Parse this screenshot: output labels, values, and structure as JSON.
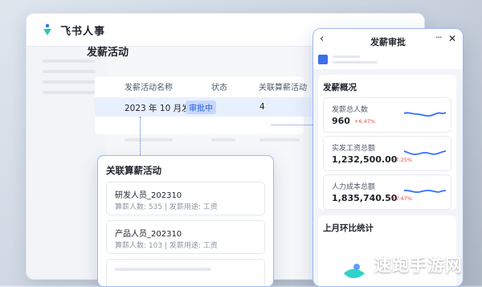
{
  "app": {
    "title": "飞书人事"
  },
  "page": {
    "title": "发薪活动"
  },
  "table": {
    "headers": [
      "发薪活动名称",
      "状态",
      "关联算薪活动"
    ],
    "row": {
      "name": "2023 年 10 月发薪",
      "status": "审批中",
      "count": "4"
    }
  },
  "related": {
    "title": "关联算薪活动",
    "items": [
      {
        "name": "研发人员_202310",
        "meta": "算薪人数: 535 | 发薪用途: 工资"
      },
      {
        "name": "产品人员_202310",
        "meta": "算薪人数: 103 | 发薪用途: 工资"
      }
    ]
  },
  "approval": {
    "title": "发薪审批",
    "overview_title": "发薪概况",
    "metrics": [
      {
        "label": "发薪总人数",
        "value": "960",
        "delta": "+6.47%"
      },
      {
        "label": "实发工资总额",
        "value": "1,232,500.00",
        "delta": "+7.25%"
      },
      {
        "label": "人力成本总额",
        "value": "1,835,740.50",
        "delta": "+7.47%"
      }
    ],
    "mom_title": "上月环比统计"
  },
  "icons": {
    "back": "chevron-left-icon",
    "more": "more-icon",
    "close": "close-icon"
  },
  "colors": {
    "accent": "#3370ff",
    "up": "#e8473c"
  },
  "watermark": {
    "text": "速跑手游网",
    "sub": "SUPAOQISHI.COM"
  }
}
